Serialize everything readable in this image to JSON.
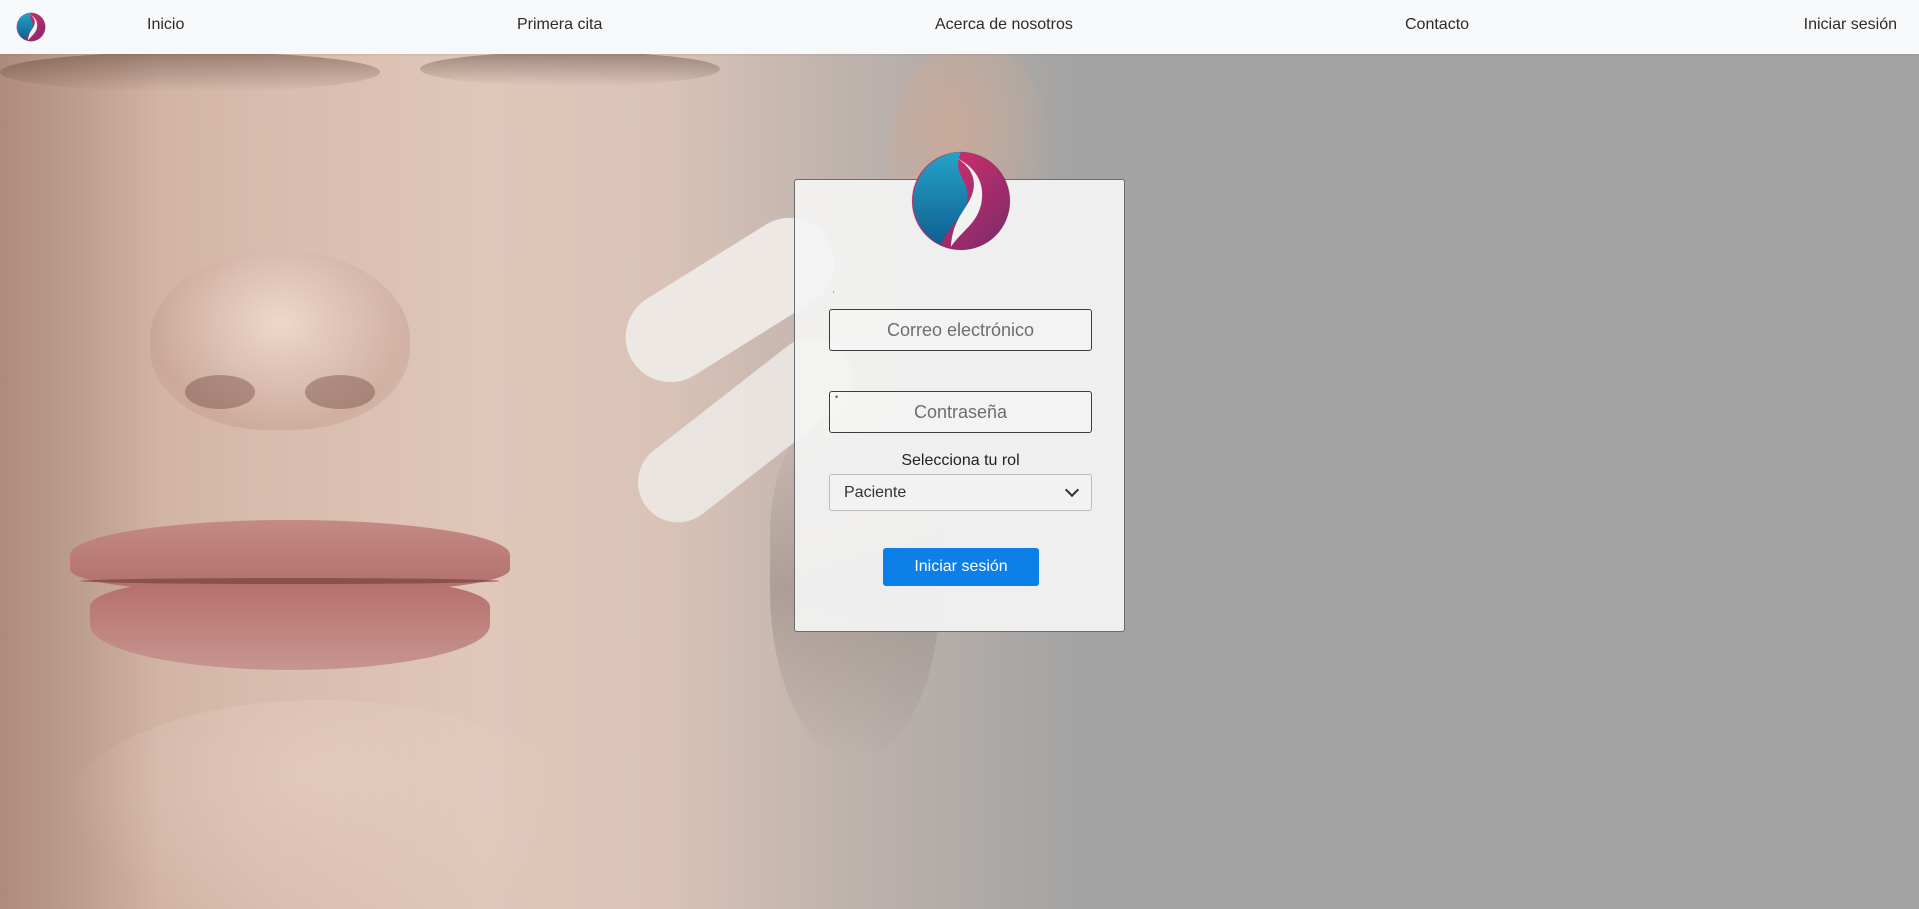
{
  "nav": {
    "logo_icon": "brand-logo-icon",
    "links": [
      "Inicio",
      "Primera cita",
      "Acerca de nosotros",
      "Contacto",
      "Iniciar sesión"
    ]
  },
  "login": {
    "logo_icon": "brand-logo-icon",
    "email_placeholder": "Correo electrónico",
    "password_placeholder": "Contraseña",
    "role_label": "Selecciona tu rol",
    "role_selected": "Paciente",
    "submit_label": "Iniciar sesión"
  },
  "colors": {
    "primary": "#0d7fe8",
    "brand_magenta": "#d32a6a",
    "brand_teal": "#1a8cb3",
    "navbar_bg": "#f7f8fa",
    "overlay_gray": "#a3a3a3"
  }
}
